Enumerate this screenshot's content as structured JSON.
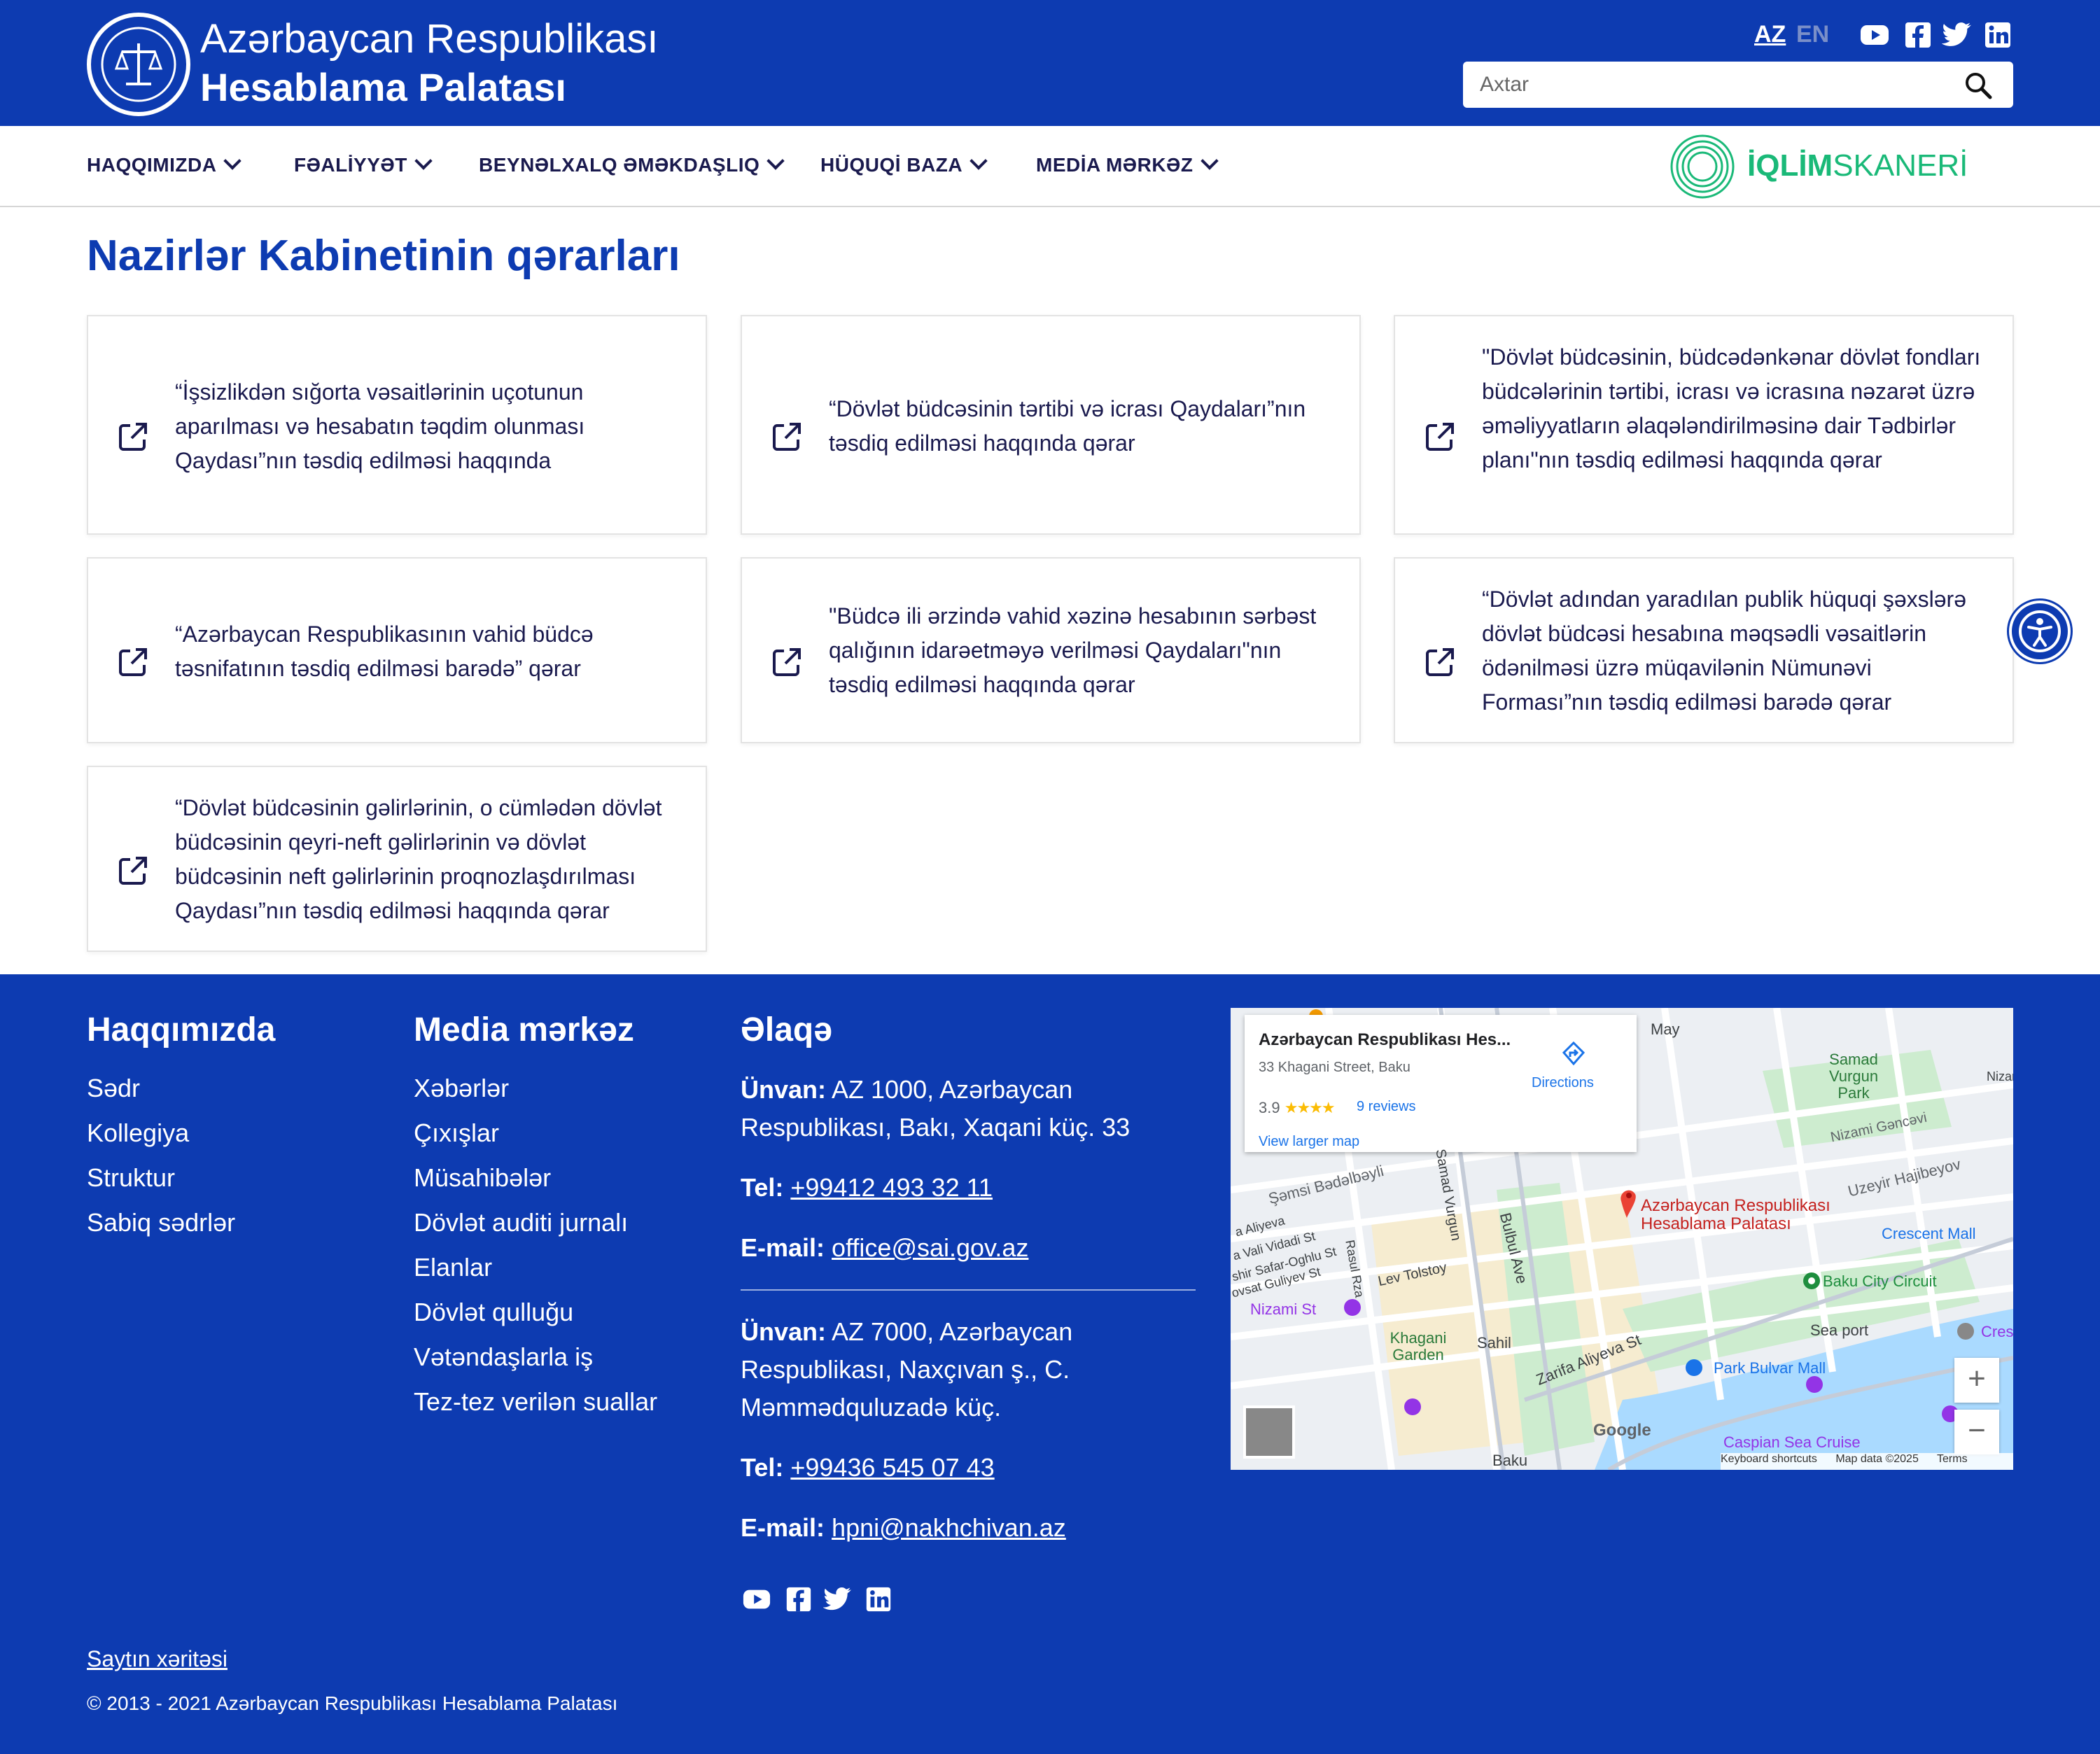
{
  "header": {
    "brand_line1": "Azərbaycan Respublikası",
    "brand_line2": "Hesablama Palatası",
    "lang_az": "AZ",
    "lang_en": "EN",
    "search_placeholder": "Axtar",
    "social_icons": [
      "youtube-icon",
      "facebook-icon",
      "twitter-icon",
      "linkedin-icon"
    ]
  },
  "nav": {
    "items": [
      {
        "label": "HAQQIMIZDA"
      },
      {
        "label": "FƏALİYYƏT"
      },
      {
        "label": "BEYNƏLXALQ ƏMƏKDAŞLIQ"
      },
      {
        "label": "HÜQUQİ BAZA"
      },
      {
        "label": "MEDİA MƏRKƏZ"
      }
    ],
    "partner_bold": "İQLİM",
    "partner_rest": "SKANERİ"
  },
  "main": {
    "title": "Nazirlər Kabinetinin qərarları",
    "cards": [
      {
        "text": "“İşsizlikdən sığorta vəsaitlərinin uçotunun aparılması və hesabatın təqdim olunması Qaydası”nın təsdiq edilməsi haqqında"
      },
      {
        "text": "“Dövlət büdcəsinin tərtibi və icrası Qaydaları”nın təsdiq edilməsi haqqında qərar"
      },
      {
        "text": "\"Dövlət büdcəsinin, büdcədənkənar dövlət fondları büdcələrinin tərtibi, icrası və icrasına nəzarət üzrə əməliyyatların əlaqələndirilməsinə dair Tədbirlər planı\"nın təsdiq edilməsi haqqında qərar"
      },
      {
        "text": "“Azərbaycan Respublikasının vahid büdcə təsnifatının təsdiq edilməsi barədə” qərar"
      },
      {
        "text": "\"Büdcə ili ərzində vahid xəzinə hesabının sərbəst qalığının idarəetməyə verilməsi Qaydaları\"nın təsdiq edilməsi haqqında qərar"
      },
      {
        "text": "“Dövlət adından yaradılan publik hüquqi şəxslərə dövlət büdcəsi hesabına məqsədli vəsaitlərin ödənilməsi üzrə müqavilənin Nümunəvi Forması”nın təsdiq edilməsi barədə qərar"
      },
      {
        "text": "“Dövlət büdcəsinin gəlirlərinin, o cümlədən dövlət büdcəsinin qeyri-neft gəlirlərinin və dövlət büdcəsinin neft gəlirlərinin proqnozlaşdırılması Qaydası”nın təsdiq edilməsi haqqında qərar"
      }
    ]
  },
  "footer": {
    "about": {
      "heading": "Haqqımızda",
      "links": [
        "Sədr",
        "Kollegiya",
        "Struktur",
        "Sabiq sədrlər"
      ]
    },
    "media": {
      "heading": "Media mərkəz",
      "links": [
        "Xəbərlər",
        "Çıxışlar",
        "Müsahibələr",
        "Dövlət auditi jurnalı",
        "Elanlar",
        "Dövlət qulluğu",
        "Vətəndaşlarla iş",
        "Tez-tez verilən suallar"
      ]
    },
    "contact": {
      "heading": "Əlaqə",
      "addr_label": "Ünvan:",
      "tel_label": "Tel:",
      "email_label": "E-mail:",
      "baku_address": "AZ 1000, Azərbaycan Respublikası, Bakı, Xaqani küç. 33",
      "baku_tel": "+99412 493 32 11",
      "baku_email": "office@sai.gov.az",
      "nakh_address": "AZ 7000, Azərbaycan Respublikası, Naxçıvan ş., C. Məmmədquluzadə küç.",
      "nakh_tel": "+99436 545 07 43",
      "nakh_email": "hpni@nakhchivan.az"
    },
    "sitemap": "Saytın xəritəsi",
    "copyright": "© 2013 - 2021 Azərbaycan Respublikası Hesablama Palatası"
  },
  "map": {
    "place_title": "Azərbaycan Respublikası Hes...",
    "place_address": "33 Khagani Street, Baku",
    "rating": "3.9",
    "stars": "★★★★",
    "reviews": "9 reviews",
    "larger_map": "View larger map",
    "directions": "Directions",
    "pin_label_1": "Azərbaycan Respublikası",
    "pin_label_2": "Hesablama Palatası",
    "labels": {
      "samad_vurgun_park": "Samad Vurgun Park",
      "nizami_gencavi": "Nizami Gəncəvi",
      "uzeyir": "Uzeyir Hajibeyov",
      "semsi": "Şəmsi Bədəlbəyli",
      "crescent": "Crescent Mall",
      "baku_city_circuit": "Baku City Circuit",
      "nizami_st": "Nizami St",
      "lev_tolstoy": "Lev Tolstoy",
      "rasul_rza": "Rasul Rza",
      "samad_vurgun": "Samad Vurgun",
      "bulbul": "Bulbul Ave",
      "khagani_garden": "Khagani Garden",
      "sahil": "Sahil",
      "zarifa": "Zarifa Aliyeva St",
      "sea_port": "Sea port",
      "park_bulvar": "Park Bulvar Mall",
      "caspian": "Caspian Sea Cruise",
      "baku": "Baku",
      "may": "May",
      "nizam": "Nizam",
      "cres": "Cres",
      "aliyeva": "a Aliyeva",
      "vali": "a Vali Vidadi St",
      "safar": "shir Safar-Oghlu St",
      "guliyev": "ovsat Guliyev St"
    },
    "google": "Google",
    "keyboard": "Keyboard shortcuts",
    "map_data": "Map data ©2025",
    "terms": "Terms"
  }
}
